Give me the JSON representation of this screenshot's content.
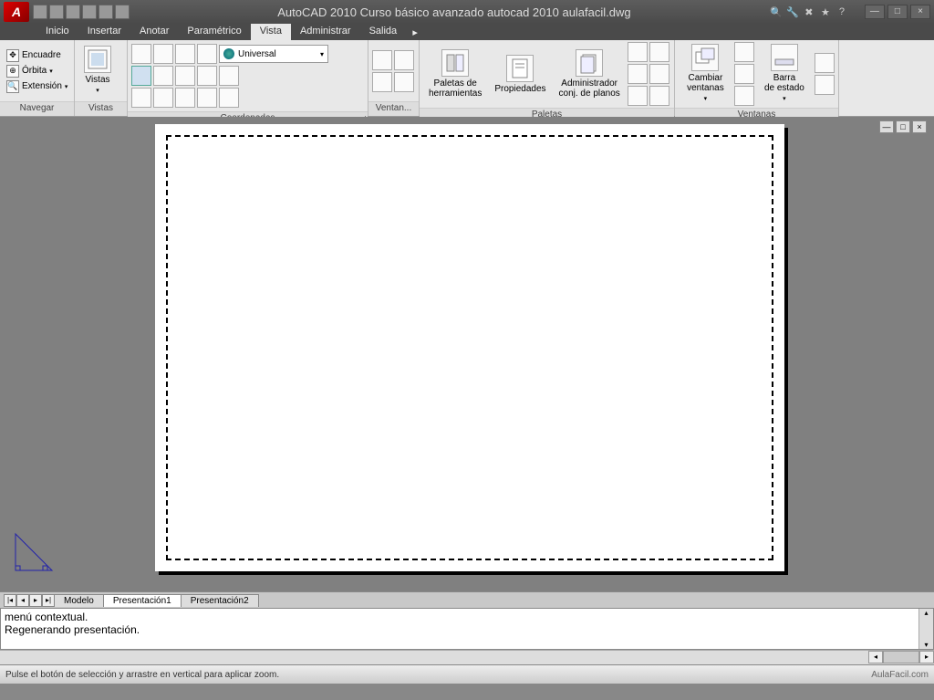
{
  "title": "AutoCAD 2010   Curso básico avanzado autocad 2010 aulafacil.dwg",
  "menus": {
    "inicio": "Inicio",
    "insertar": "Insertar",
    "anotar": "Anotar",
    "parametrico": "Paramétrico",
    "vista": "Vista",
    "administrar": "Administrar",
    "salida": "Salida"
  },
  "ribbon": {
    "navegar": {
      "label": "Navegar",
      "encuadre": "Encuadre",
      "orbita": "Órbita",
      "extension": "Extensión"
    },
    "vistas": {
      "label": "Vistas",
      "btn": "Vistas"
    },
    "coordenadas": {
      "label": "Coordenadas",
      "combo": "Universal"
    },
    "ventanas_small": {
      "label": "Ventan..."
    },
    "paletas": {
      "label": "Paletas",
      "herramientas": "Paletas de\nherramientas",
      "propiedades": "Propiedades",
      "admin": "Administrador\nconj. de planos"
    },
    "ventanas": {
      "label": "Ventanas",
      "cambiar": "Cambiar\nventanas",
      "barra": "Barra\nde estado"
    }
  },
  "layout_tabs": {
    "modelo": "Modelo",
    "p1": "Presentación1",
    "p2": "Presentación2"
  },
  "cmd": {
    "l1": "menú contextual.",
    "l2": "Regenerando presentación."
  },
  "status": {
    "hint": "Pulse el botón de selección y arrastre en vertical para aplicar zoom.",
    "brand": "AulaFacil.com"
  }
}
